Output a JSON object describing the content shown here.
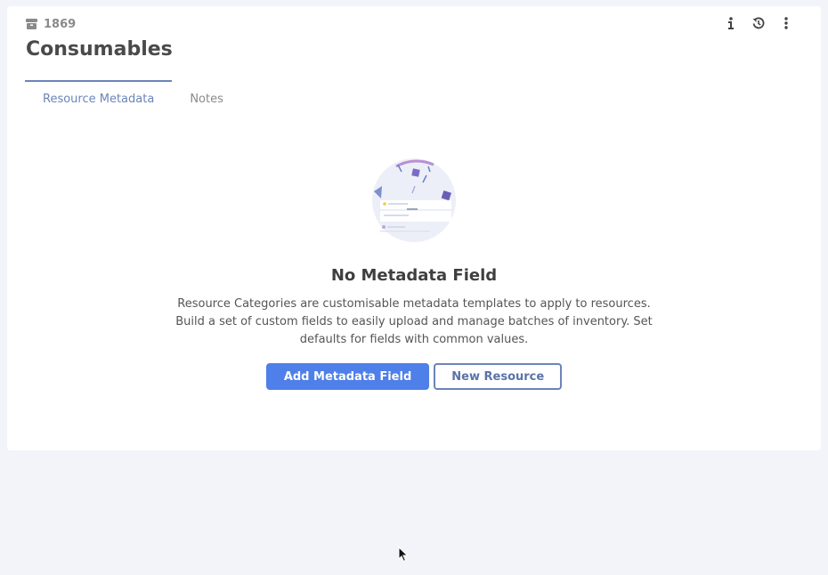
{
  "header": {
    "record_id": "1869",
    "title": "Consumables",
    "actions": [
      {
        "name": "info-icon"
      },
      {
        "name": "history-icon"
      },
      {
        "name": "more-vertical-icon"
      }
    ]
  },
  "tabs": [
    {
      "label": "Resource Metadata",
      "active": true
    },
    {
      "label": "Notes",
      "active": false
    }
  ],
  "empty_state": {
    "heading": "No Metadata Field",
    "description": "Resource Categories are customisable metadata templates to apply to resources. Build a set of custom fields to easily upload and manage batches of inventory. Set defaults for fields with common values.",
    "primary_button": "Add Metadata Field",
    "secondary_button": "New Resource"
  },
  "colors": {
    "accent": "#4f7fe8",
    "tab_active": "#6b84b8",
    "background": "#f2f4fa"
  }
}
